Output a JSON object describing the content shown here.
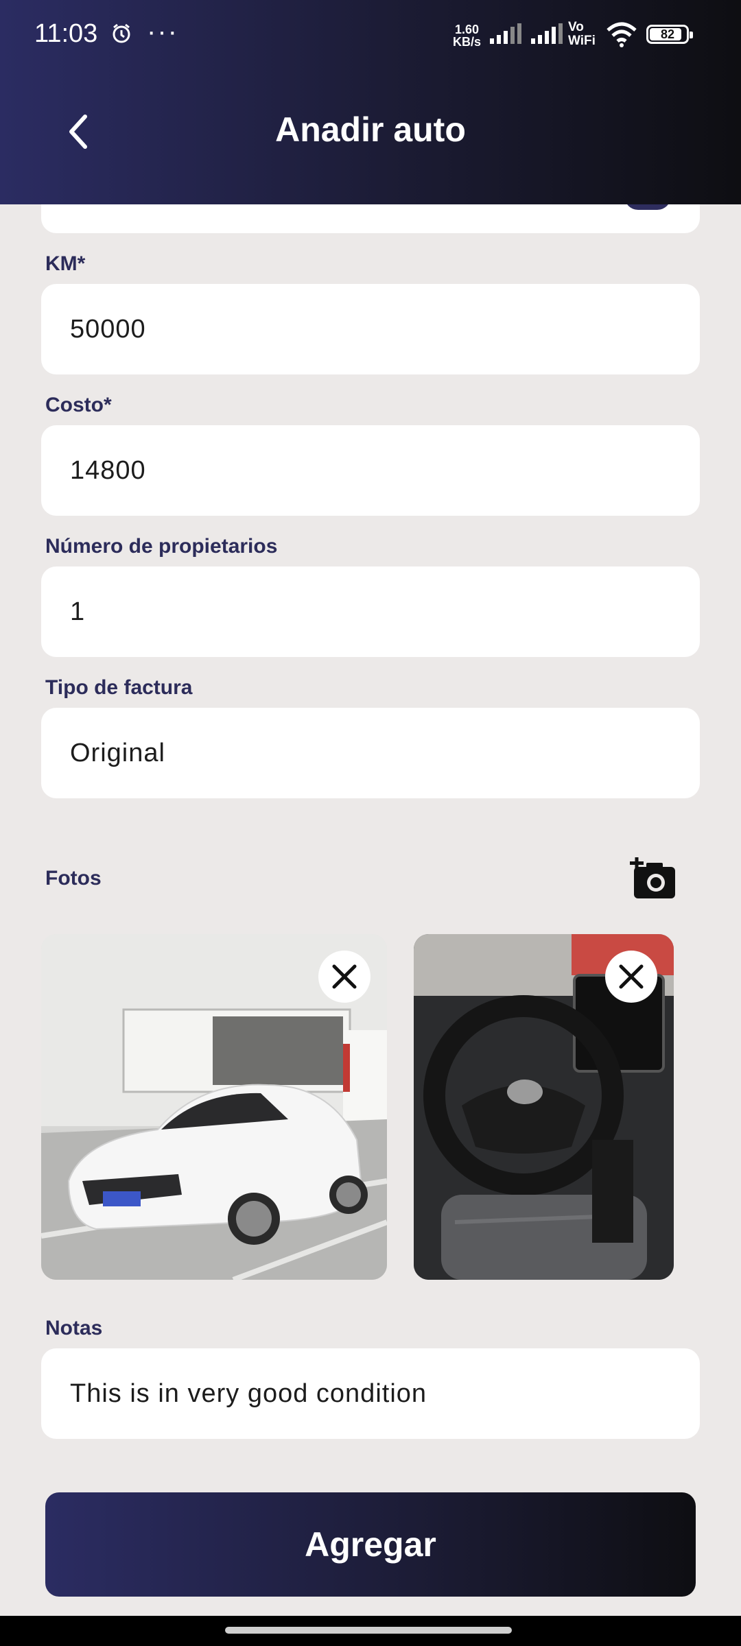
{
  "status_bar": {
    "time": "11:03",
    "network_speed_value": "1.60",
    "network_speed_unit": "KB/s",
    "vowifi_top": "Vo",
    "vowifi_bottom": "WiFi",
    "battery_level": "82",
    "icons": [
      "alarm-icon",
      "more-dots-icon",
      "signal-icon",
      "signal-icon",
      "wifi-icon",
      "battery-icon"
    ]
  },
  "header": {
    "title": "Anadir auto",
    "back_icon": "chevron-left-icon"
  },
  "form": {
    "km": {
      "label": "KM*",
      "value": "50000"
    },
    "costo": {
      "label": "Costo*",
      "value": "14800"
    },
    "propietarios": {
      "label": "Número de propietarios",
      "value": "1"
    },
    "factura": {
      "label": "Tipo de factura",
      "value": "Original"
    },
    "fotos": {
      "label": "Fotos",
      "add_icon": "add-camera-icon",
      "remove_icon": "close-icon"
    },
    "notas": {
      "label": "Notas",
      "value": "This is in very good condition"
    }
  },
  "actions": {
    "submit_label": "Agregar"
  },
  "colors": {
    "primary": "#2b2c62",
    "dark": "#0e0e12",
    "background": "#ece9e8",
    "label": "#2c2c5a"
  }
}
